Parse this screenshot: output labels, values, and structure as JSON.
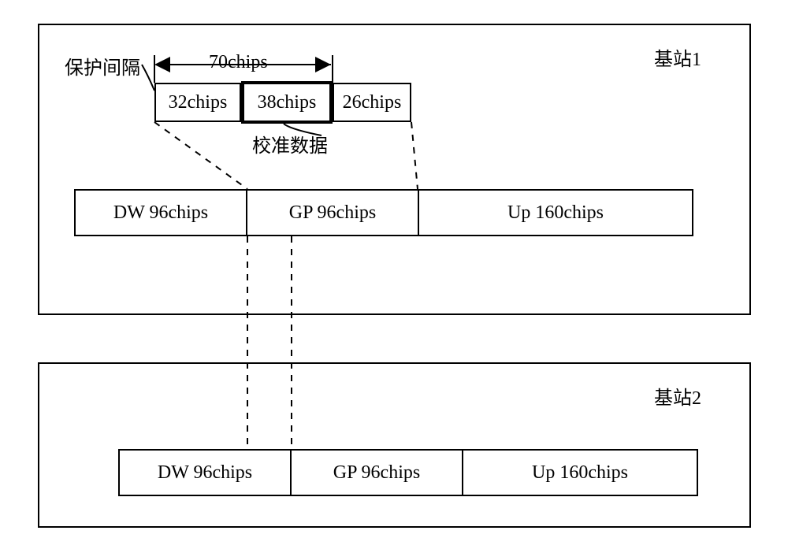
{
  "station1": {
    "title": "基站1",
    "guard_label": "保护间隔",
    "span_label": "70chips",
    "calib_label": "校准数据",
    "gp_cells": {
      "a": "32chips",
      "b": "38chips",
      "c": "26chips"
    },
    "row": {
      "dw": "DW 96chips",
      "gp": "GP 96chips",
      "up": "Up 160chips"
    }
  },
  "station2": {
    "title": "基站2",
    "row": {
      "dw": "DW 96chips",
      "gp": "GP 96chips",
      "up": "Up 160chips"
    }
  }
}
